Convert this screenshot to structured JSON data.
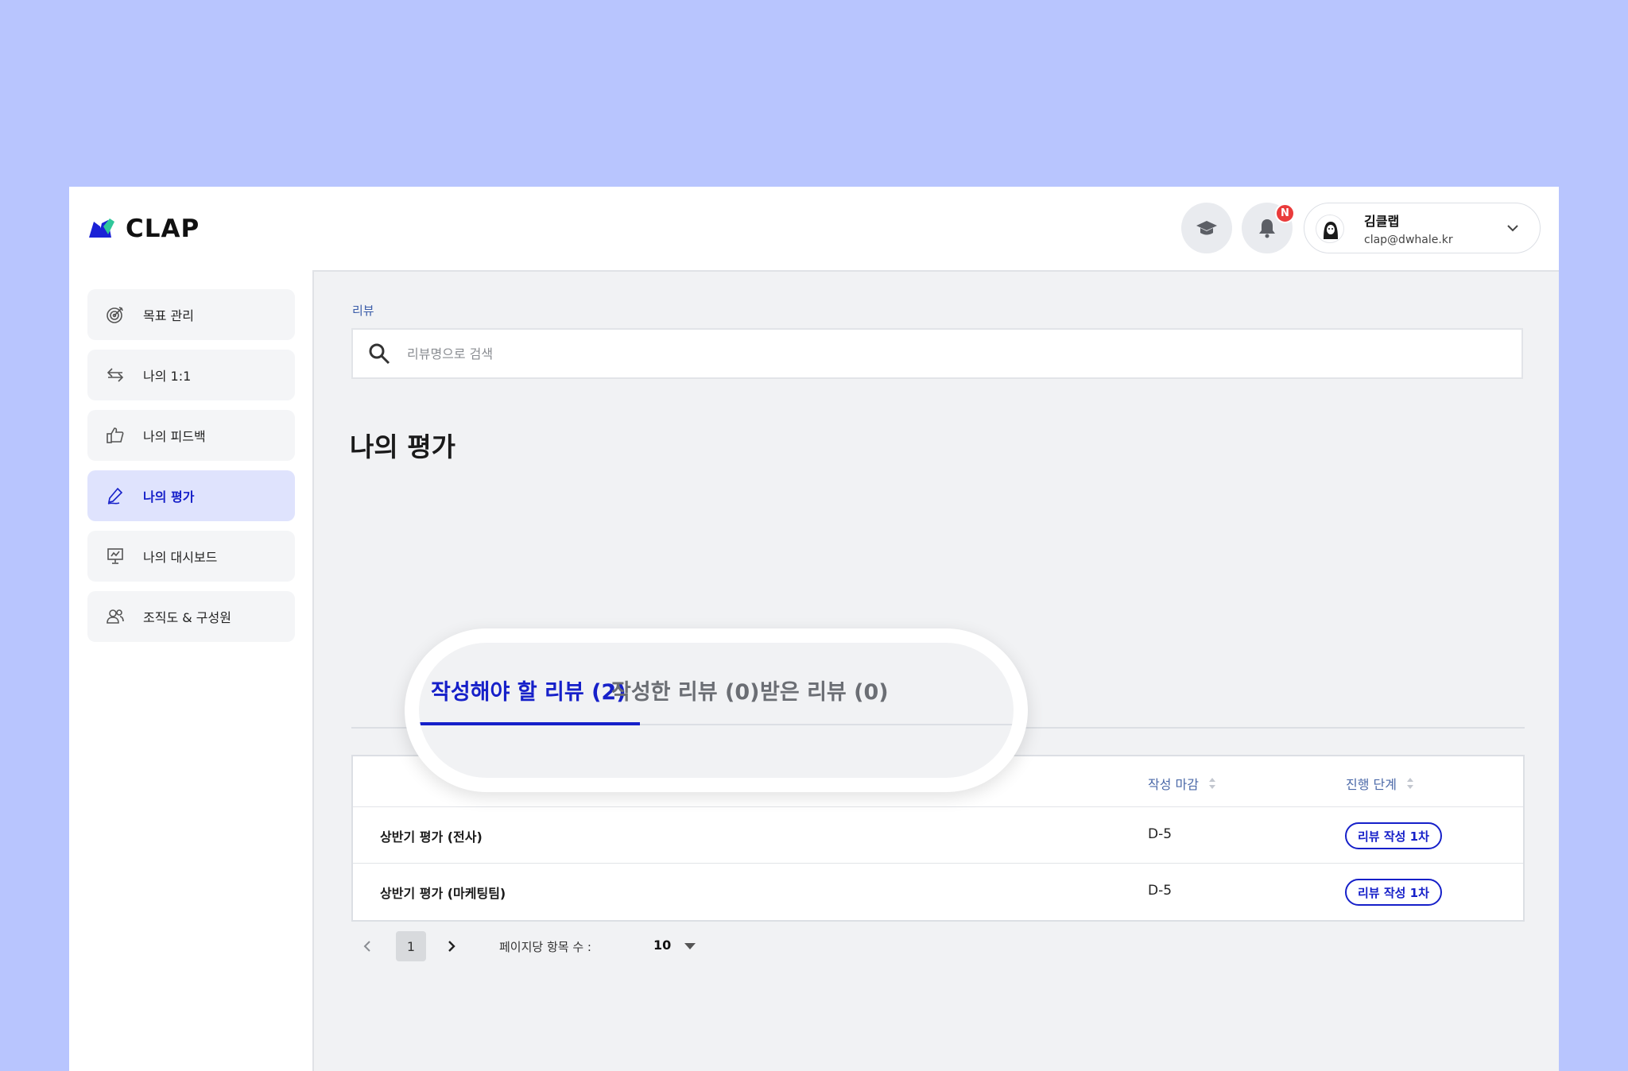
{
  "brand": {
    "name": "CLAP"
  },
  "header": {
    "notification_badge": "N",
    "user": {
      "name": "김클랩",
      "email": "clap@dwhale.kr"
    }
  },
  "sidebar": {
    "items": [
      {
        "label": "목표 관리",
        "icon": "target-icon",
        "active": false
      },
      {
        "label": "나의 1:1",
        "icon": "exchange-arrows-icon",
        "active": false
      },
      {
        "label": "나의 피드백",
        "icon": "thumbs-up-icon",
        "active": false
      },
      {
        "label": "나의 평가",
        "icon": "pen-sign-icon",
        "active": true
      },
      {
        "label": "나의 대시보드",
        "icon": "presentation-chart-icon",
        "active": false
      },
      {
        "label": "조직도 & 구성원",
        "icon": "users-icon",
        "active": false
      }
    ]
  },
  "main": {
    "breadcrumb": "리뷰",
    "search": {
      "placeholder": "리뷰명으로 검색",
      "value": ""
    },
    "page_title": "나의 평가",
    "tabs": [
      {
        "label": "작성해야 할 리뷰 (2)",
        "active": true
      },
      {
        "label": "작성한 리뷰 (0)",
        "active": false
      },
      {
        "label": "받은 리뷰 (0)",
        "active": false
      }
    ],
    "table": {
      "columns": [
        "작성 마감",
        "진행 단계"
      ],
      "rows": [
        {
          "name": "상반기 평가 (전사)",
          "due": "D-5",
          "stage": "리뷰 작성 1차"
        },
        {
          "name": "상반기 평가 (마케팅팀)",
          "due": "D-5",
          "stage": "리뷰 작성 1차"
        }
      ]
    },
    "pagination": {
      "current_page": "1",
      "per_page_label": "페이지당 항목 수 :",
      "per_page_value": "10"
    }
  },
  "colors": {
    "background": "#b8c5fe",
    "accent": "#1620c9",
    "active_nav_bg": "#dfe3fd",
    "badge_red": "#ea3b3b"
  }
}
